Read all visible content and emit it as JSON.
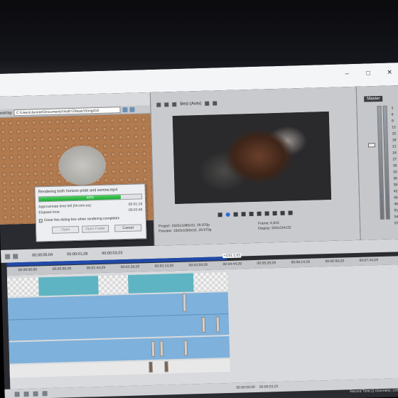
{
  "media": {
    "tab": "overlay",
    "path": "C:\\Users\\Jeniree\\Documents\\\\HallYZMusic\\Song418"
  },
  "dialog": {
    "title": "Rendering both horizon pride and sorrow.mp4",
    "progress_pct": 80,
    "progress_label": "80%",
    "time_left_label": "Approximate time left (hh:mm:ss):",
    "time_left_value": "00:01:18",
    "elapsed_label": "Elapsed time:",
    "elapsed_value": "00:03:46",
    "close_checkbox_label": "Close this dialog box when rendering completes",
    "close_checked": true,
    "buttons": {
      "open": "Open",
      "open_folder": "Open Folder",
      "cancel": "Cancel"
    }
  },
  "preview": {
    "quality": "Best (Auto)",
    "project_label": "Project:",
    "project_value": "1920x1080x32, 29.970p",
    "preview_label": "Preview:",
    "preview_value": "1920x1080x32, 29.970p",
    "frame_label": "Frame:",
    "frame_value": "6,815",
    "display_label": "Display:",
    "display_value": "593x334x32"
  },
  "master": {
    "label": "Master",
    "scale": [
      "3",
      "6",
      "9",
      "12",
      "15",
      "18",
      "21",
      "24",
      "27",
      "30",
      "33",
      "36",
      "39",
      "42",
      "45",
      "48",
      "51",
      "54",
      "57"
    ]
  },
  "timeline": {
    "time_a": "00:00:05;04",
    "time_b": "00:00:01;28",
    "time_c": "00:00:03;23",
    "selection_label": "+3:51:1;03",
    "ruler": [
      "00:00:00;00",
      "00:00:59;29",
      "00:01:44;29",
      "00:02:29;29",
      "00:03:14;29",
      "00:03:59;29",
      "00:04:44;29",
      "00:05:29;29",
      "00:06:14;29",
      "00:06:59;29",
      "00:07:44;29"
    ],
    "bottom_time": "00:00:00;00",
    "bottom_end": "00:00:03;23",
    "status": "Record Time (2 channels): 229:36:55"
  }
}
